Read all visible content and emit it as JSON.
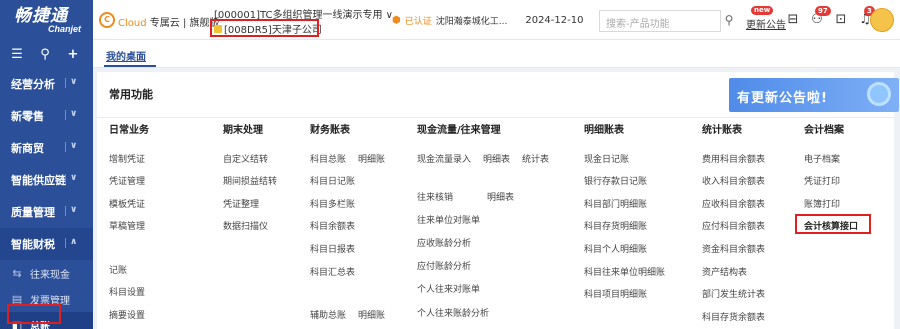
{
  "sidebar": {
    "logo_main": "畅捷通",
    "logo_sub": "Chanjet",
    "tools": [
      "☰",
      "⚲",
      "+"
    ],
    "items": [
      {
        "label": "经营分析",
        "chev": "∨"
      },
      {
        "label": "新零售",
        "chev": "∨"
      },
      {
        "label": "新商贸",
        "chev": "∨"
      },
      {
        "label": "智能供应链",
        "chev": "∨"
      },
      {
        "label": "质量管理",
        "chev": "∨"
      },
      {
        "label": "智能财税",
        "chev": "∧"
      }
    ],
    "sub_items": [
      {
        "icon": "⇆",
        "label": "往来现金"
      },
      {
        "icon": "▤",
        "label": "发票管理"
      },
      {
        "icon": "◧",
        "label": "总账"
      }
    ]
  },
  "topbar": {
    "cloud_logo": "C",
    "cloud_brand": "Cloud",
    "cloud_suffix": "专属云 | 旗舰版",
    "account_line1": "[000001]TC多组织管理一线演示专用 ∨",
    "account_line2": "[008DR5]天津子公司",
    "cert_icon": "⬢",
    "cert_label": "已认证",
    "company": "沈阳瀚泰城化工...",
    "date": "2024-12-10",
    "search_placeholder": "搜索-产品功能",
    "search_icon": "⚲",
    "notice_label": "更新公告",
    "new_badge": "new",
    "icon_calendar": "⊟",
    "badge_users": "97",
    "icon_users": "⚇",
    "icon_chat": "⊡",
    "badge_bell": "3",
    "icon_bell": "♫"
  },
  "tabs": {
    "home": "我的桌面"
  },
  "card": {
    "title": "常用功能",
    "banner": "有更新公告啦!"
  },
  "columns": [
    {
      "head": "日常业务"
    },
    {
      "head": "期末处理"
    },
    {
      "head": "财务账表"
    },
    {
      "head": "现金流量/往来管理"
    },
    {
      "head": "明细账表"
    },
    {
      "head": "统计账表"
    },
    {
      "head": "会计档案"
    }
  ],
  "cells": {
    "c0_0": "增制凭证",
    "c0_1": "凭证管理",
    "c0_2": "模板凭证",
    "c0_3": "草稿管理",
    "c0_4": "记账",
    "c0_5": "科目设置",
    "c0_6": "摘要设置",
    "c1_0": "自定义结转",
    "c1_1": "期间损益结转",
    "c1_2": "凭证整理",
    "c1_3": "数据扫描仪",
    "c2_0a": "科目总账",
    "c2_0b": "明细账",
    "c2_1": "科目日记账",
    "c2_2": "科目多栏账",
    "c2_3": "科目余额表",
    "c2_4": "科目日报表",
    "c2_5": "科目汇总表",
    "c2_6a": "辅助总账",
    "c2_6b": "明细账",
    "c3_0a": "现金流量录入",
    "c3_0b": "明细表",
    "c3_0c": "统计表",
    "c3_1a": "往来核销",
    "c3_1b": "明细表",
    "c3_2": "往来单位对账单",
    "c3_3": "应收账龄分析",
    "c3_4": "应付账龄分析",
    "c3_5": "个人往来对账单",
    "c3_6": "个人往来账龄分析",
    "c4_0": "现金日记账",
    "c4_1": "银行存款日记账",
    "c4_2": "科目部门明细账",
    "c4_3": "科目存货明细账",
    "c4_4": "科目个人明细账",
    "c4_5": "科目往来单位明细账",
    "c4_6": "科目项目明细账",
    "c5_0": "费用科目余额表",
    "c5_1": "收入科目余额表",
    "c5_2": "应收科目余额表",
    "c5_3": "应付科目余额表",
    "c5_4": "资金科目余额表",
    "c5_5": "资产结构表",
    "c5_6": "部门发生统计表",
    "c5_7": "科目存货余额表",
    "c6_0": "电子档案",
    "c6_1": "凭证打印",
    "c6_2": "账簿打印",
    "c6_3": "会计核算接口"
  },
  "colors": {
    "sidebar": "#2c4f9a",
    "accent_orange": "#f08a1c",
    "highlight_red": "#e02020"
  }
}
